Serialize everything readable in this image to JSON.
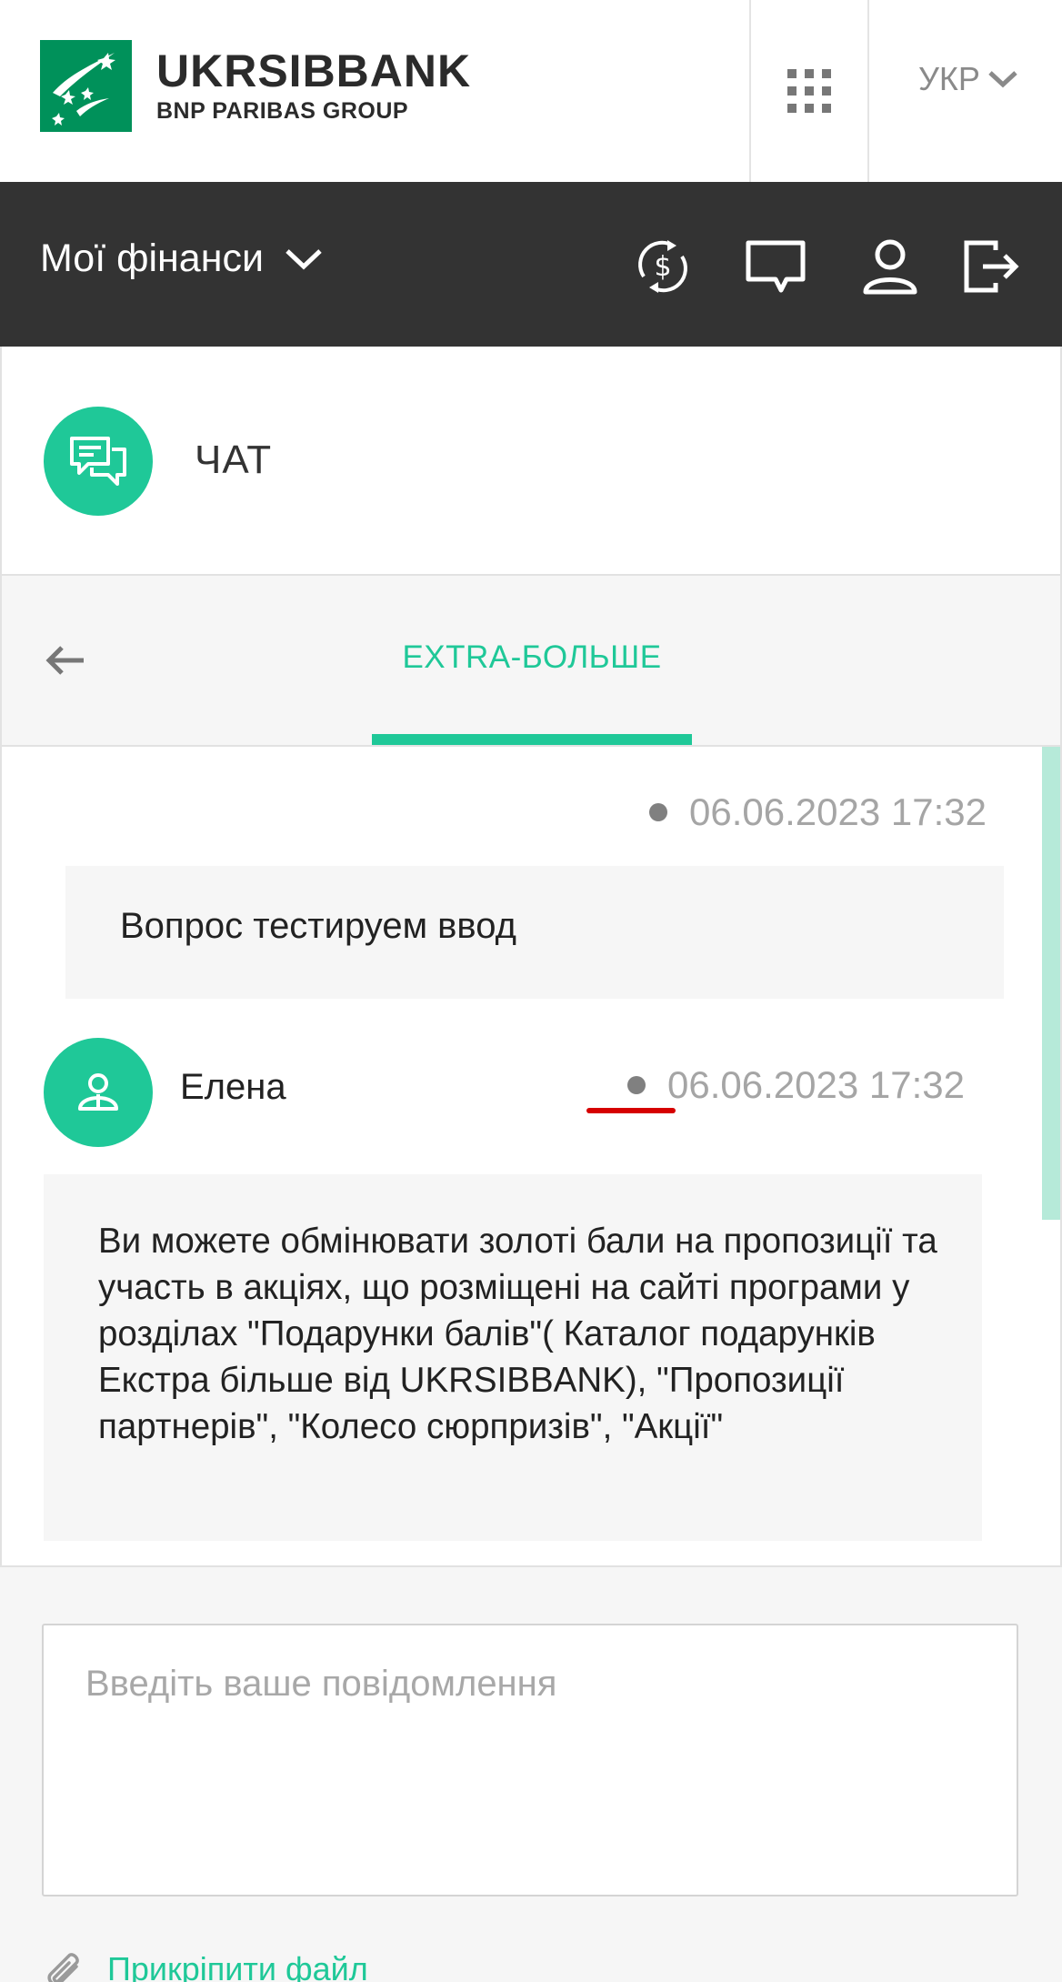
{
  "header": {
    "brand_name": "UKRSIBBANK",
    "brand_sub": "BNP PARIBAS GROUP",
    "apps_icon": "apps-grid-icon",
    "language": "УКР"
  },
  "nav": {
    "finances_label": "Мої фінанси",
    "icons": [
      "currency-exchange-icon",
      "chat-bubble-icon",
      "user-profile-icon",
      "logout-icon"
    ]
  },
  "chat": {
    "title": "ЧАТ",
    "icon": "chat-icon"
  },
  "tabs": {
    "back_icon": "arrow-left-icon",
    "active_label": "EXTRA-БОЛЬШЕ"
  },
  "messages": [
    {
      "type": "user",
      "timestamp": "06.06.2023 17:32",
      "text": "Вопрос тестируем ввод"
    },
    {
      "type": "agent",
      "author": "Елена",
      "timestamp": "06.06.2023 17:32",
      "text": "Ви можете обмінювати золоті бали на пропозиції та участь в акціях, що розміщені на сайті програми у розділах \"Подарунки балів\"( Каталог подарунків Екстра більше від UKRSIBBANK), \"Пропозиції партнерів\", \"Колесо сюрпризів\", \"Акції\""
    }
  ],
  "composer": {
    "value": "",
    "placeholder": "Введіть ваше повідомлення",
    "attach_label": "Прикріпити файл"
  },
  "colors": {
    "accent": "#1fc898",
    "nav_bg": "#333333",
    "brand_green": "#00915a",
    "annotation_red": "#d60000"
  }
}
